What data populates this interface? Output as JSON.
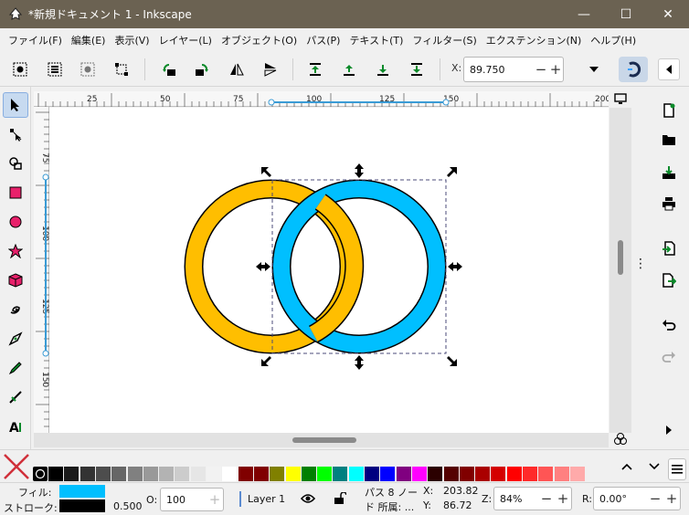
{
  "window": {
    "title": "*新規ドキュメント 1 - Inkscape",
    "minimize": "—",
    "maximize": "☐",
    "close": "✕"
  },
  "menu": [
    "ファイル(F)",
    "編集(E)",
    "表示(V)",
    "レイヤー(L)",
    "オブジェクト(O)",
    "パス(P)",
    "テキスト(T)",
    "フィルター(S)",
    "エクステンション(N)",
    "ヘルプ(H)"
  ],
  "toolbar": {
    "x_label": "X:",
    "x_value": "89.750",
    "minus": "−",
    "plus": "+"
  },
  "ruler": {
    "h_ticks": [
      "25",
      "50",
      "75",
      "100",
      "125",
      "150",
      "200"
    ],
    "v_ticks": [
      "75",
      "100",
      "125",
      "150"
    ]
  },
  "canvas": {
    "circle_left_color": "#ffbe00",
    "circle_right_color": "#00bfff"
  },
  "palette": {
    "colors": [
      "#000000",
      "#1a1a1a",
      "#333333",
      "#4d4d4d",
      "#666666",
      "#808080",
      "#999999",
      "#b3b3b3",
      "#cccccc",
      "#e6e6e6",
      "#f2f2f2",
      "#ffffff",
      "#800000",
      "#800000",
      "#808000",
      "#ffff00",
      "#008000",
      "#00ff00",
      "#008080",
      "#00ffff",
      "#000080",
      "#0000ff",
      "#800080",
      "#ff00ff",
      "#2b0000",
      "#550000",
      "#800000",
      "#aa0000",
      "#d40000",
      "#ff0000",
      "#ff2a2a",
      "#ff5555",
      "#ff8080",
      "#ffaaaa"
    ]
  },
  "status": {
    "fill_label": "フィル:",
    "stroke_label": "ストローク:",
    "fill_color": "#00bfff",
    "stroke_color": "#000000",
    "stroke_width": "0.500",
    "opacity_label": "O:",
    "opacity_value": "100",
    "layer_name": "Layer 1",
    "info_line1": "パス 8 ノー",
    "info_line2": "ド 所属: ...",
    "x_label": "X:",
    "x_value": "203.82",
    "y_label": "Y:",
    "y_value": "86.72",
    "zoom_label": "Z:",
    "zoom_value": "84%",
    "rotation_label": "R:",
    "rotation_value": "0.00°",
    "minus": "−",
    "plus": "+"
  }
}
